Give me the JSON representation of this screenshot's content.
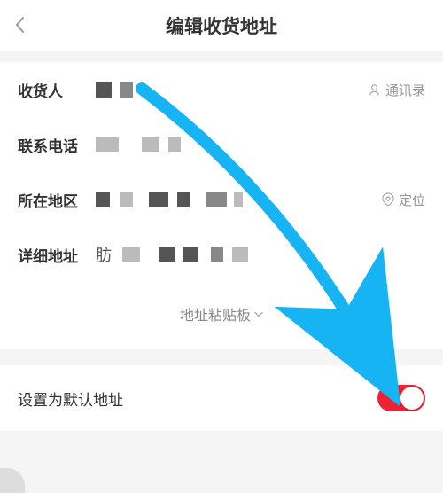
{
  "header": {
    "title": "编辑收货地址"
  },
  "form": {
    "recipient": {
      "label": "收货人",
      "contactsAction": "通讯录"
    },
    "phone": {
      "label": "联系电话"
    },
    "region": {
      "label": "所在地区",
      "locateAction": "定位"
    },
    "detail": {
      "label": "详细地址"
    }
  },
  "clipboard": {
    "label": "地址粘贴板"
  },
  "defaultAddress": {
    "label": "设置为默认地址",
    "enabled": true
  }
}
